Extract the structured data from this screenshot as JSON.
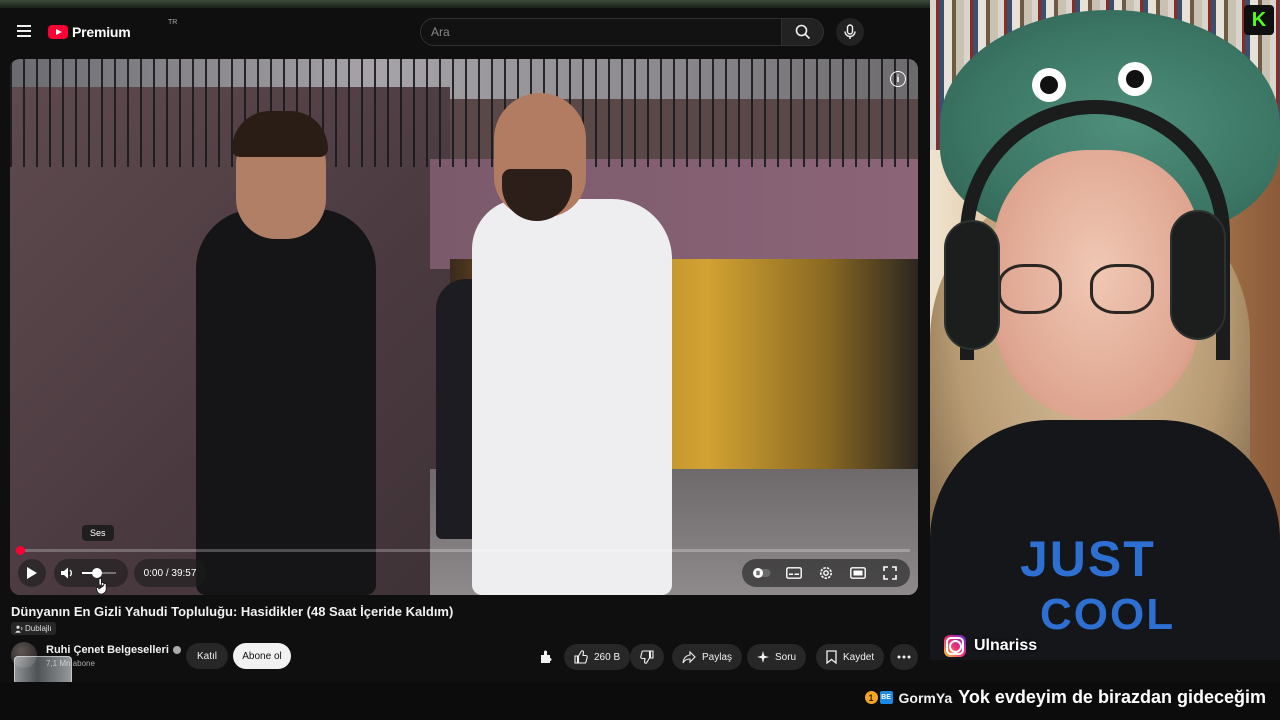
{
  "masthead": {
    "logo_text": "Premium",
    "logo_country": "TR",
    "search_placeholder": "Ara"
  },
  "player": {
    "tooltip": "Ses",
    "time": "0:00 / 39:57",
    "progress_fraction": 0.005,
    "volume_fraction": 0.45
  },
  "video": {
    "title": "Dünyanın En Gizli Yahudi Topluluğu: Hasidikler (48 Saat İçeride Kaldım)",
    "dub_badge": "Dublajlı",
    "channel_name": "Ruhi Çenet Belgeselleri",
    "subscribers": "7,1 Mn abone",
    "join_label": "Katıl",
    "subscribe_label": "Abone ol",
    "like_count": "260 B",
    "share_label": "Paylaş",
    "ask_label": "Soru",
    "save_label": "Kaydet"
  },
  "overlay": {
    "instagram_handle": "Ulnariss",
    "shirt_text_line1": "JUST",
    "shirt_text_line2": "COOL",
    "kick_logo": "K"
  },
  "chat": {
    "badge_box": "BE",
    "username": "GormYa",
    "message": "Yok evdeyim de birazdan gideceğim"
  },
  "colors": {
    "youtube_red": "#ff0033",
    "kick_green": "#53fc18",
    "background": "#0f0f0f"
  }
}
